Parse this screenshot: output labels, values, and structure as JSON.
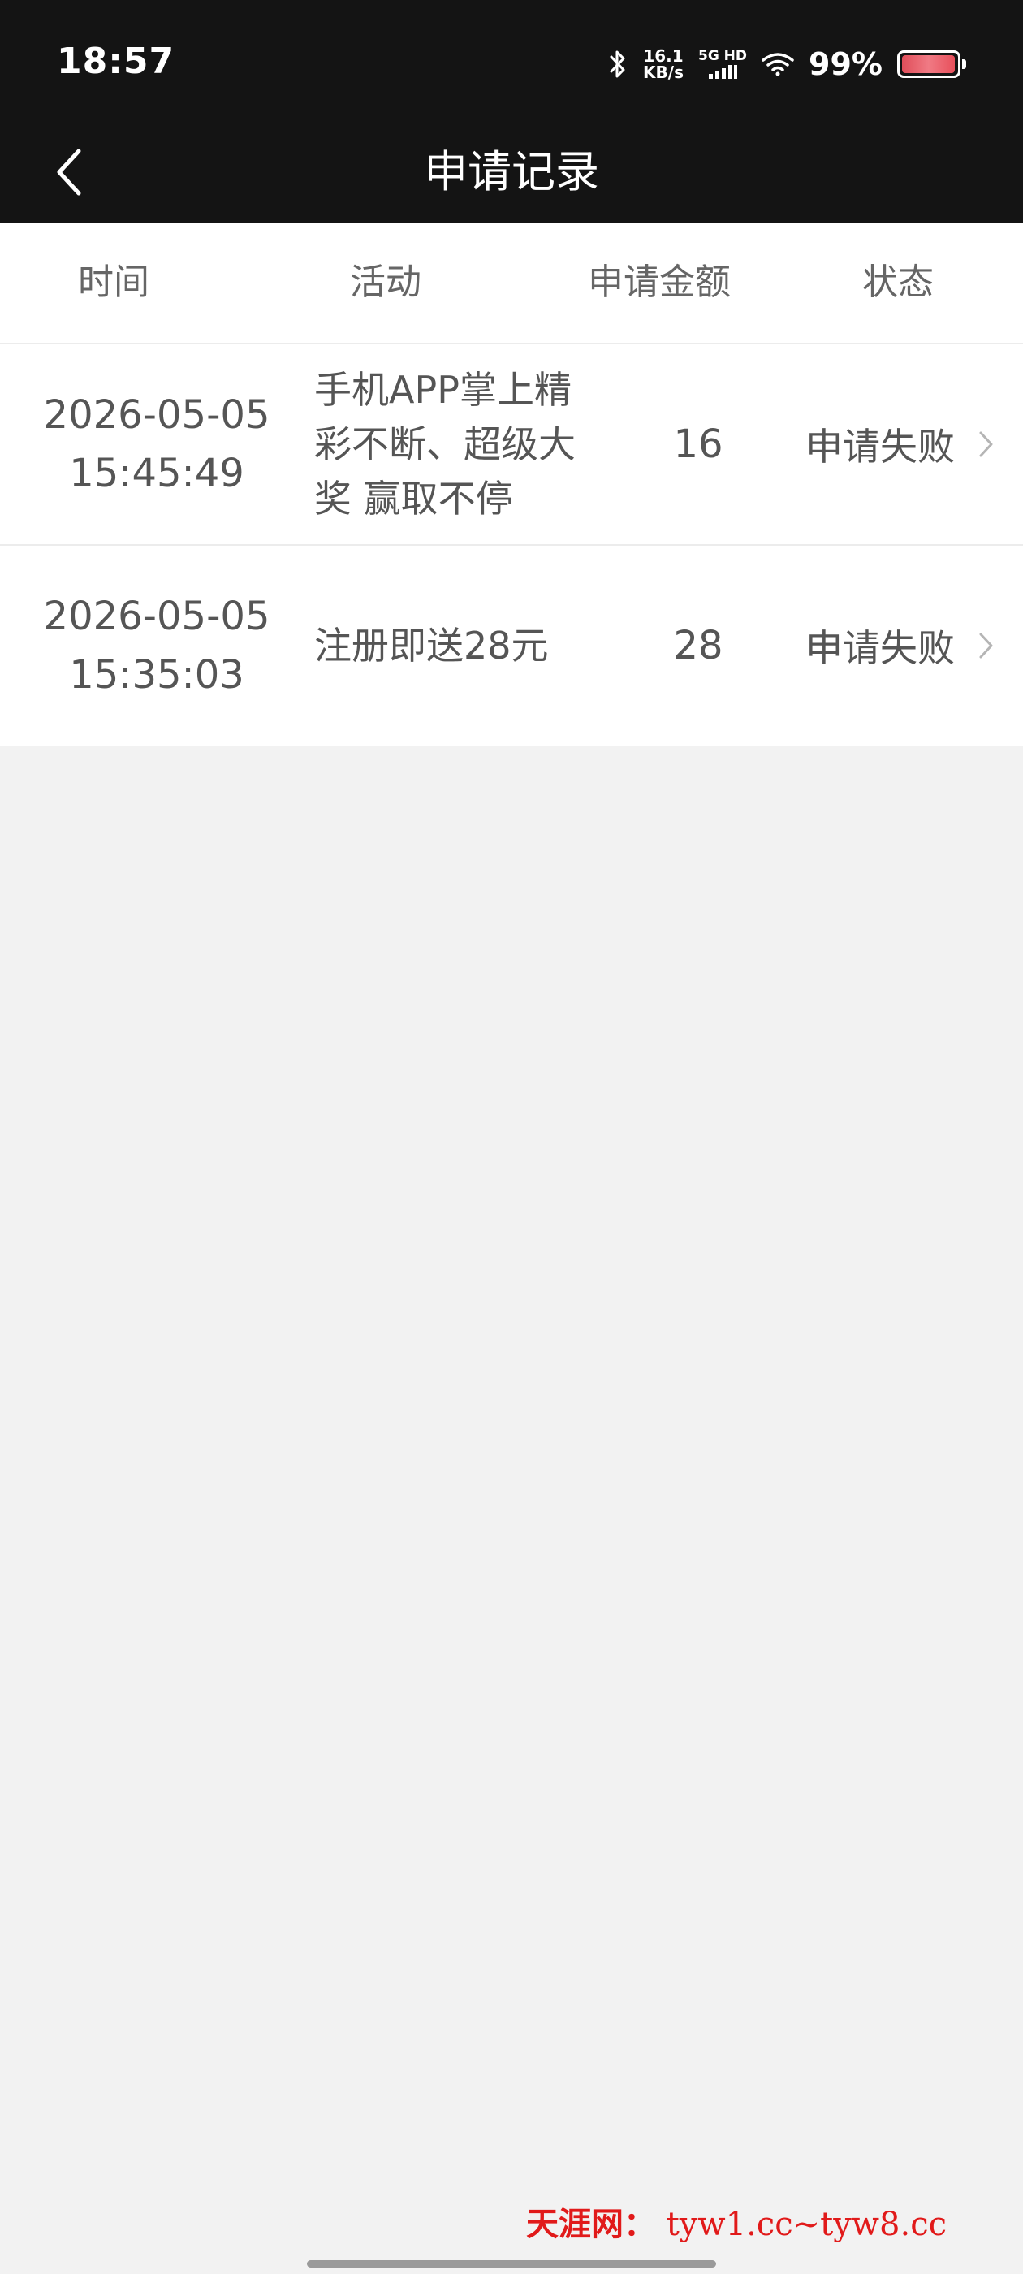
{
  "status_bar": {
    "time": "18:57",
    "net_speed_value": "16.1",
    "net_speed_unit": "KB/s",
    "signal_label": "5G HD",
    "battery_percent": "99%",
    "battery_level": 0.99,
    "battery_color": "#e8505c"
  },
  "header": {
    "back_icon": "chevron-left-icon",
    "title": "申请记录"
  },
  "table": {
    "columns": [
      "时间",
      "活动",
      "申请金额",
      "状态"
    ],
    "rows": [
      {
        "date": "2026-05-05",
        "time": "15:45:49",
        "activity_lines": [
          "手机APP掌上精",
          "彩不断、超级大",
          "奖 赢取不停"
        ],
        "amount": "16",
        "status": "申请失败"
      },
      {
        "date": "2026-05-05",
        "time": "15:35:03",
        "activity_lines": [
          "注册即送28元"
        ],
        "amount": "28",
        "status": "申请失败"
      }
    ]
  },
  "watermark": {
    "site_name": "天涯网：",
    "urls": "tyw1.cc~tyw8.cc"
  },
  "colors": {
    "bar_background": "#141414",
    "page_background": "#f2f2f2",
    "watermark_red": "#e11a1a"
  }
}
